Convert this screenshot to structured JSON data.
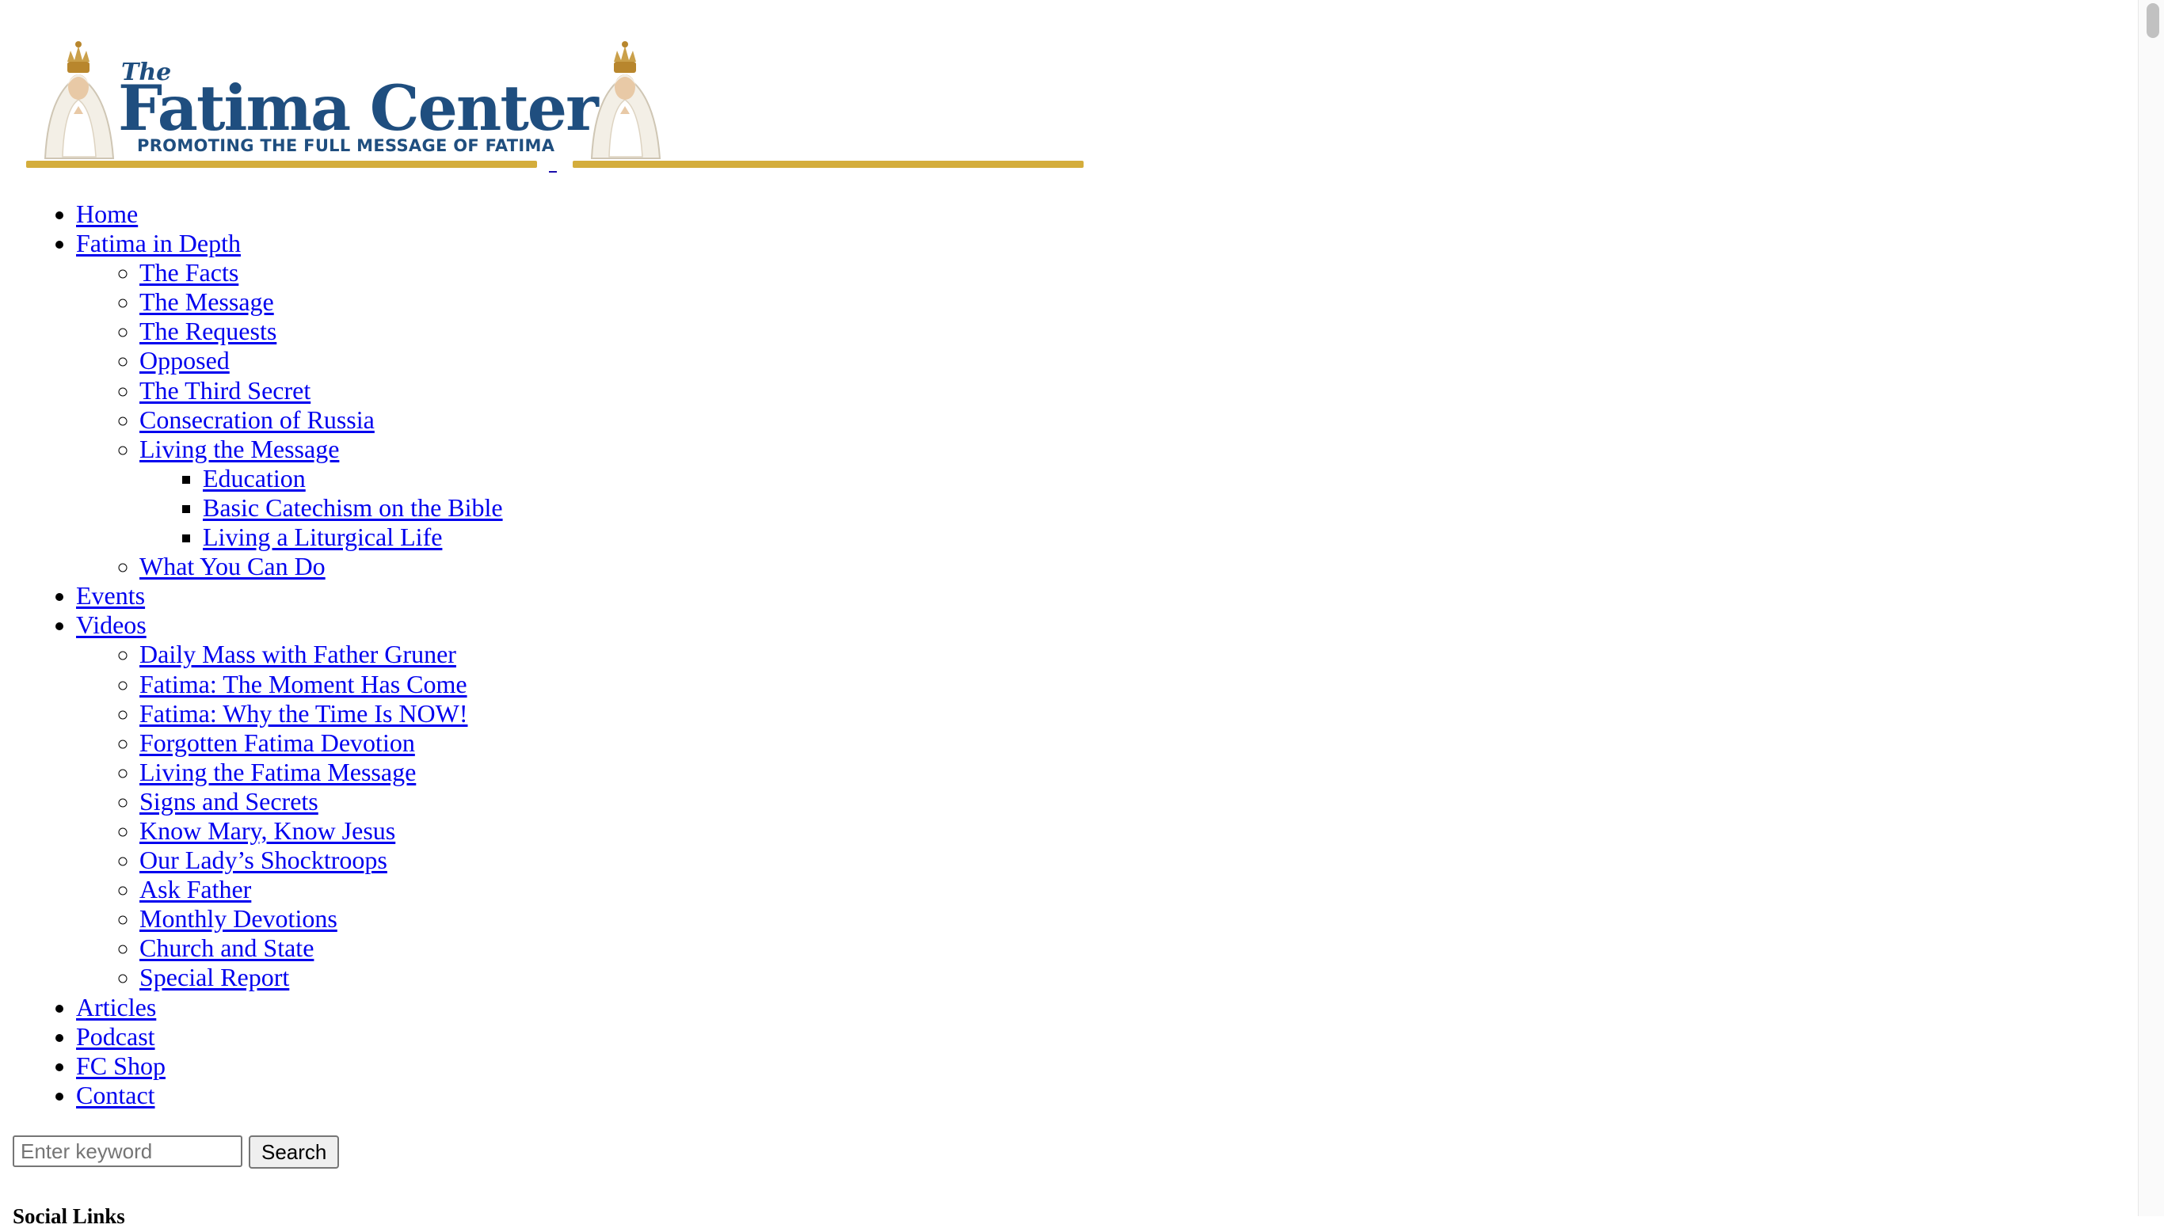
{
  "header": {
    "logo": {
      "the": "The",
      "name": "Fatima Center",
      "tagline": "PROMOTING THE FULL MESSAGE OF FATIMA"
    },
    "colors": {
      "brand_blue": "#1f4e7f",
      "gold": "#d4ad3c",
      "link": "#0000ee"
    }
  },
  "nav": {
    "home": "Home",
    "fatima_in_depth": {
      "label": "Fatima in Depth",
      "children": {
        "facts": "The Facts",
        "message": "The Message",
        "requests": "The Requests",
        "opposed": "Opposed",
        "third_secret": "The Third Secret",
        "consecration": "Consecration of Russia",
        "living_message": {
          "label": "Living the Message",
          "children": {
            "education": "Education",
            "catechism": "Basic Catechism on the Bible",
            "liturgical": "Living a Liturgical Life"
          }
        },
        "what_you_can_do": "What You Can Do"
      }
    },
    "events": "Events",
    "videos": {
      "label": "Videos",
      "children": {
        "daily_mass": "Daily Mass with Father Gruner",
        "moment": "Fatima: The Moment Has Come",
        "why_now": "Fatima: Why the Time Is NOW!",
        "forgotten": "Forgotten Fatima Devotion",
        "living": "Living the Fatima Message",
        "signs": "Signs and Secrets",
        "know_mary": "Know Mary, Know Jesus",
        "shocktroops": "Our Lady’s Shocktroops",
        "ask_father": "Ask Father",
        "monthly": "Monthly Devotions",
        "church_state": "Church and State",
        "special_report": "Special Report"
      }
    },
    "articles": "Articles",
    "podcast": "Podcast",
    "fc_shop": "FC Shop",
    "contact": "Contact"
  },
  "search": {
    "placeholder": "Enter keyword",
    "value": "",
    "button_label": "Search"
  },
  "sidebar": {
    "social_heading": "Social Links"
  }
}
